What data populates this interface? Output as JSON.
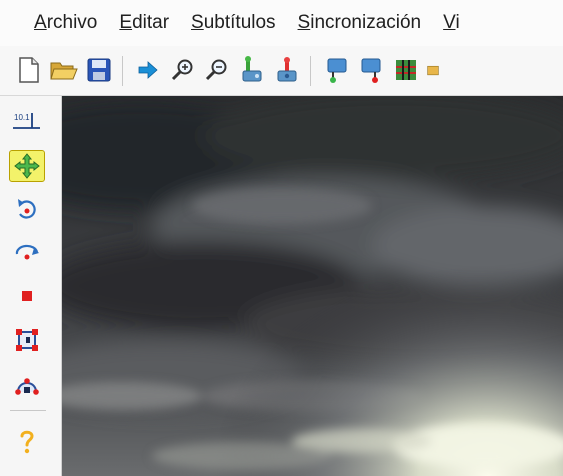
{
  "menu": {
    "items": [
      {
        "mnemonic": "A",
        "rest": "rchivo"
      },
      {
        "mnemonic": "E",
        "rest": "ditar"
      },
      {
        "mnemonic": "S",
        "rest": "ubtítulos"
      },
      {
        "mnemonic": "S",
        "rest": "incronización"
      },
      {
        "mnemonic": "V",
        "rest": "i"
      }
    ]
  },
  "toolbar": {
    "icons": [
      "new-file-icon",
      "open-folder-icon",
      "save-icon",
      "arrow-right-icon",
      "zoom-in-icon",
      "zoom-out-icon",
      "joystick-green-icon",
      "joystick-blue-icon",
      "pin-green-icon",
      "pin-red-icon",
      "grid-icon"
    ]
  },
  "sidebar": {
    "scale_label": "10.1",
    "icons": [
      "scale-tool-icon",
      "move-tool-icon",
      "rotate-z-icon",
      "rotate-x-icon",
      "stop-icon",
      "clip-tool-icon",
      "drawing-tool-icon",
      "help-icon"
    ],
    "active_color": "#f3f26a"
  },
  "colors": {
    "arrow_blue": "#1a8fd6",
    "help_yellow": "#f2b01e",
    "red": "#e02020"
  }
}
